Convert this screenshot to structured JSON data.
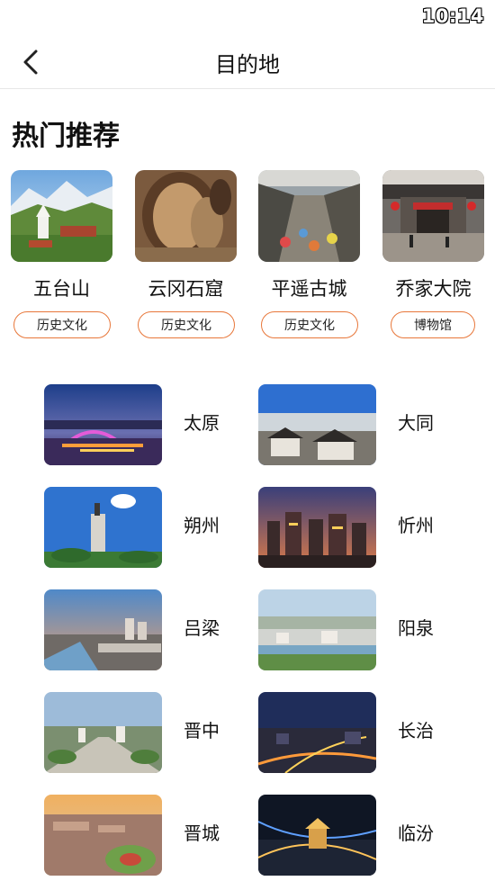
{
  "status": {
    "time": "10:14"
  },
  "header": {
    "title": "目的地",
    "back_icon": "chevron-left-icon"
  },
  "section": {
    "title": "热门推荐"
  },
  "recommendations": [
    {
      "name": "五台山",
      "tag": "历史文化"
    },
    {
      "name": "云冈石窟",
      "tag": "历史文化"
    },
    {
      "name": "平遥古城",
      "tag": "历史文化"
    },
    {
      "name": "乔家大院",
      "tag": "博物馆"
    }
  ],
  "cities": [
    {
      "name": "太原"
    },
    {
      "name": "大同"
    },
    {
      "name": "朔州"
    },
    {
      "name": "忻州"
    },
    {
      "name": "吕梁"
    },
    {
      "name": "阳泉"
    },
    {
      "name": "晋中"
    },
    {
      "name": "长治"
    },
    {
      "name": "晋城"
    },
    {
      "name": "临汾"
    }
  ],
  "colors": {
    "accent": "#e8773a",
    "text": "#111111",
    "divider": "#e6e6e6"
  }
}
